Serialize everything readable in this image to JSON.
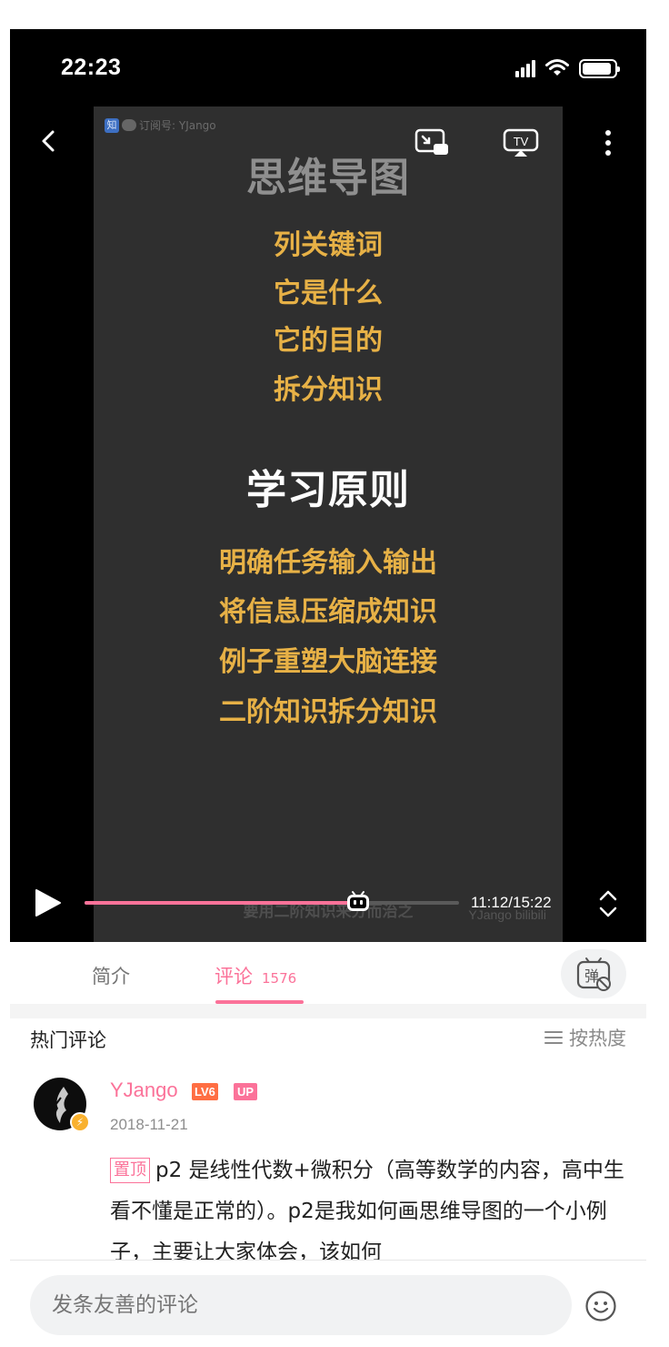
{
  "status_bar": {
    "time": "22:23"
  },
  "video": {
    "watermark_top": "订阅号: YJango",
    "slide_title": "思维导图",
    "slide_items_1": [
      "列关键词",
      "它是什么",
      "它的目的",
      "拆分知识"
    ],
    "slide_section": "学习原则",
    "slide_items_2": [
      "明确任务输入输出",
      "将信息压缩成知识",
      "例子重塑大脑连接",
      "二阶知识拆分知识"
    ],
    "subtitle": "要用二阶知识来分而治之",
    "watermark_bottom": "YJango bilibili",
    "time_readout": "11:12/15:22",
    "progress_fraction": 0.7301,
    "colors": {
      "accent": "#fb7299",
      "slide_bg": "#2f2f2f",
      "slide_yellow": "#e7b146"
    }
  },
  "tabs": {
    "intro_label": "简介",
    "comments_label": "评论",
    "comments_count": "1576",
    "danmaku_label": "弹"
  },
  "comments": {
    "section_title": "热门评论",
    "sort_label": "按热度",
    "items": [
      {
        "user": "YJango",
        "level": "LV6",
        "up_badge": "UP",
        "date": "2018-11-21",
        "pinned_label": "置顶",
        "text": "p2 是线性代数+微积分（高等数学的内容，高中生看不懂是正常的）。p2是我如何画思维导图的一个小例子，主要让大家体会，该如何"
      }
    ]
  },
  "input": {
    "placeholder": "发条友善的评论"
  },
  "icons": [
    "back-icon",
    "pip-icon",
    "tv-cast-icon",
    "more-icon",
    "play-icon",
    "fullscreen-icon",
    "danmaku-icon",
    "sort-icon",
    "emoji-icon",
    "bilibili-thumb-icon"
  ]
}
